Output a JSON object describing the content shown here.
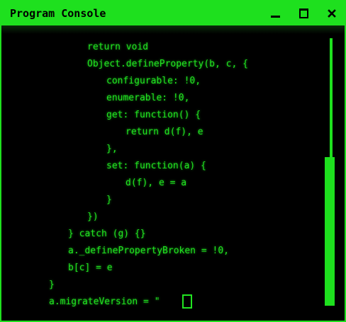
{
  "window": {
    "title": "Program Console"
  },
  "icons": {
    "minimize": "minimize-icon",
    "maximize": "maximize-icon",
    "close": "close-icon"
  },
  "colors": {
    "accent": "#1ee01e",
    "text": "#21e421",
    "background": "#000000"
  },
  "console": {
    "lines": [
      "return void",
      "Object.defineProperty(b, c, {",
      "configurable: !0,",
      "enumerable: !0,",
      "get: function() {",
      "return d(f), e",
      "},",
      "set: function(a) {",
      "d(f), e = a",
      "}",
      "})",
      "} catch (g) {}",
      "a._definePropertyBroken = !0,",
      "b[c] = e",
      "}",
      "a.migrateVersion = \""
    ]
  }
}
